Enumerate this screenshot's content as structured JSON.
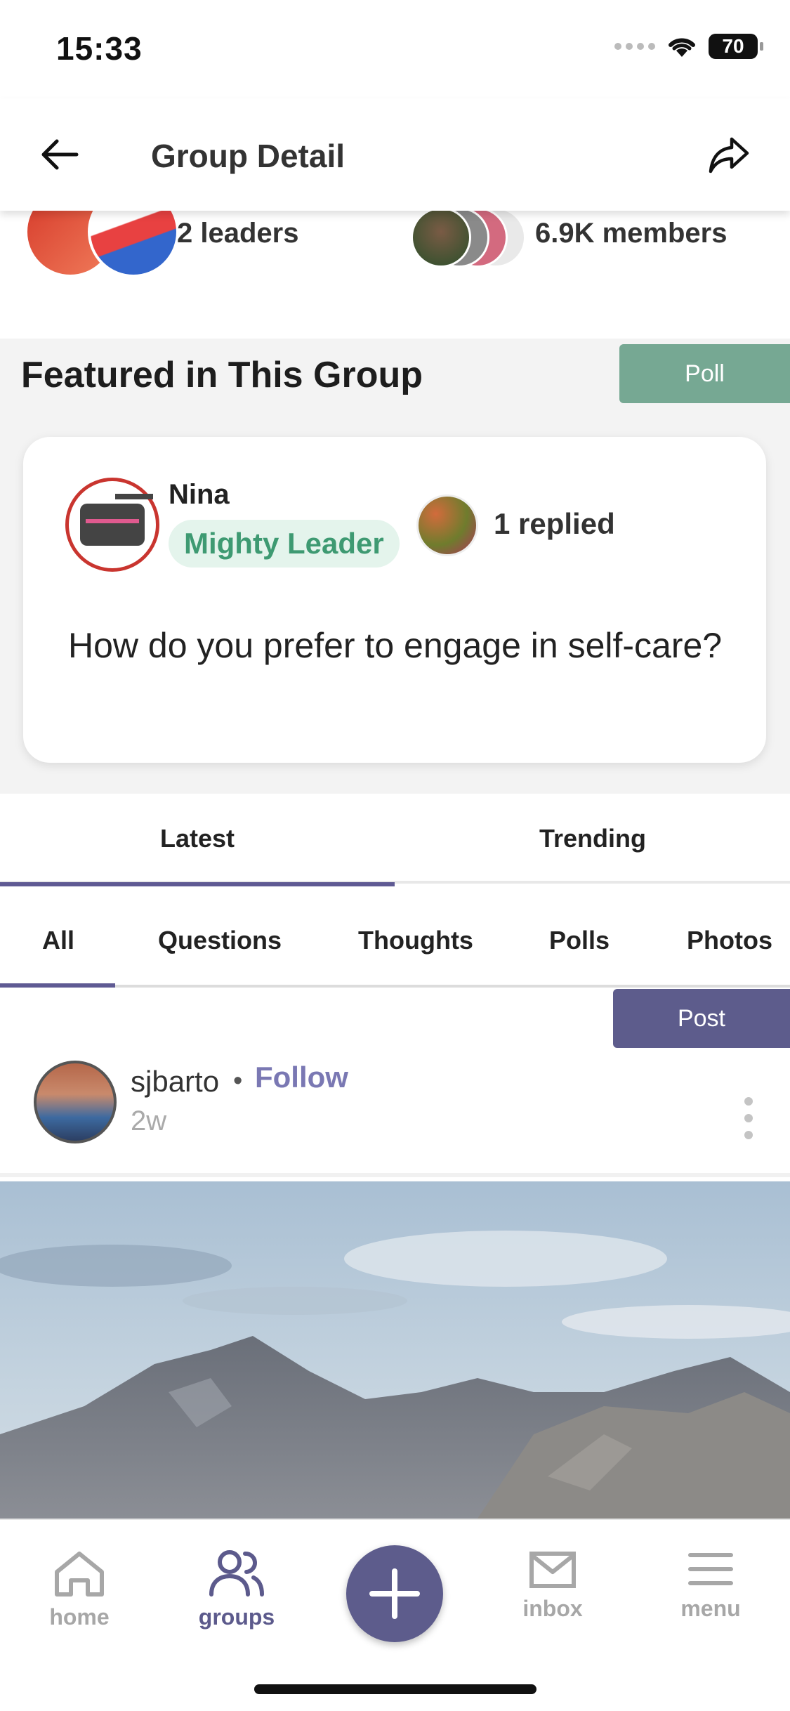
{
  "status_bar": {
    "time": "15:33",
    "battery": "70"
  },
  "header": {
    "title": "Group Detail"
  },
  "group": {
    "leaders_label": "2 leaders",
    "members_label": "6.9K members"
  },
  "featured": {
    "title": "Featured in This Group",
    "type_badge": "Poll",
    "author_name": "Nina",
    "author_badge": "Mighty Leader",
    "replied_label": "1 replied",
    "question": "How do you prefer to engage in self-care?"
  },
  "tabs": [
    {
      "label": "Latest",
      "active": true
    },
    {
      "label": "Trending",
      "active": false
    }
  ],
  "filters": [
    {
      "label": "All",
      "active": true
    },
    {
      "label": "Questions",
      "active": false
    },
    {
      "label": "Thoughts",
      "active": false
    },
    {
      "label": "Polls",
      "active": false
    },
    {
      "label": "Photos",
      "active": false
    }
  ],
  "post": {
    "type_badge": "Post",
    "username": "sjbarto",
    "separator": "•",
    "follow_label": "Follow",
    "time_ago": "2w"
  },
  "bottom_nav": {
    "home": "home",
    "groups": "groups",
    "inbox": "inbox",
    "menu": "menu"
  },
  "colors": {
    "accent": "#5d5c8c",
    "poll_badge": "#76a893",
    "leader_badge_bg": "#e4f4ec",
    "leader_badge_text": "#3e9a72",
    "follow": "#7a78b3"
  }
}
